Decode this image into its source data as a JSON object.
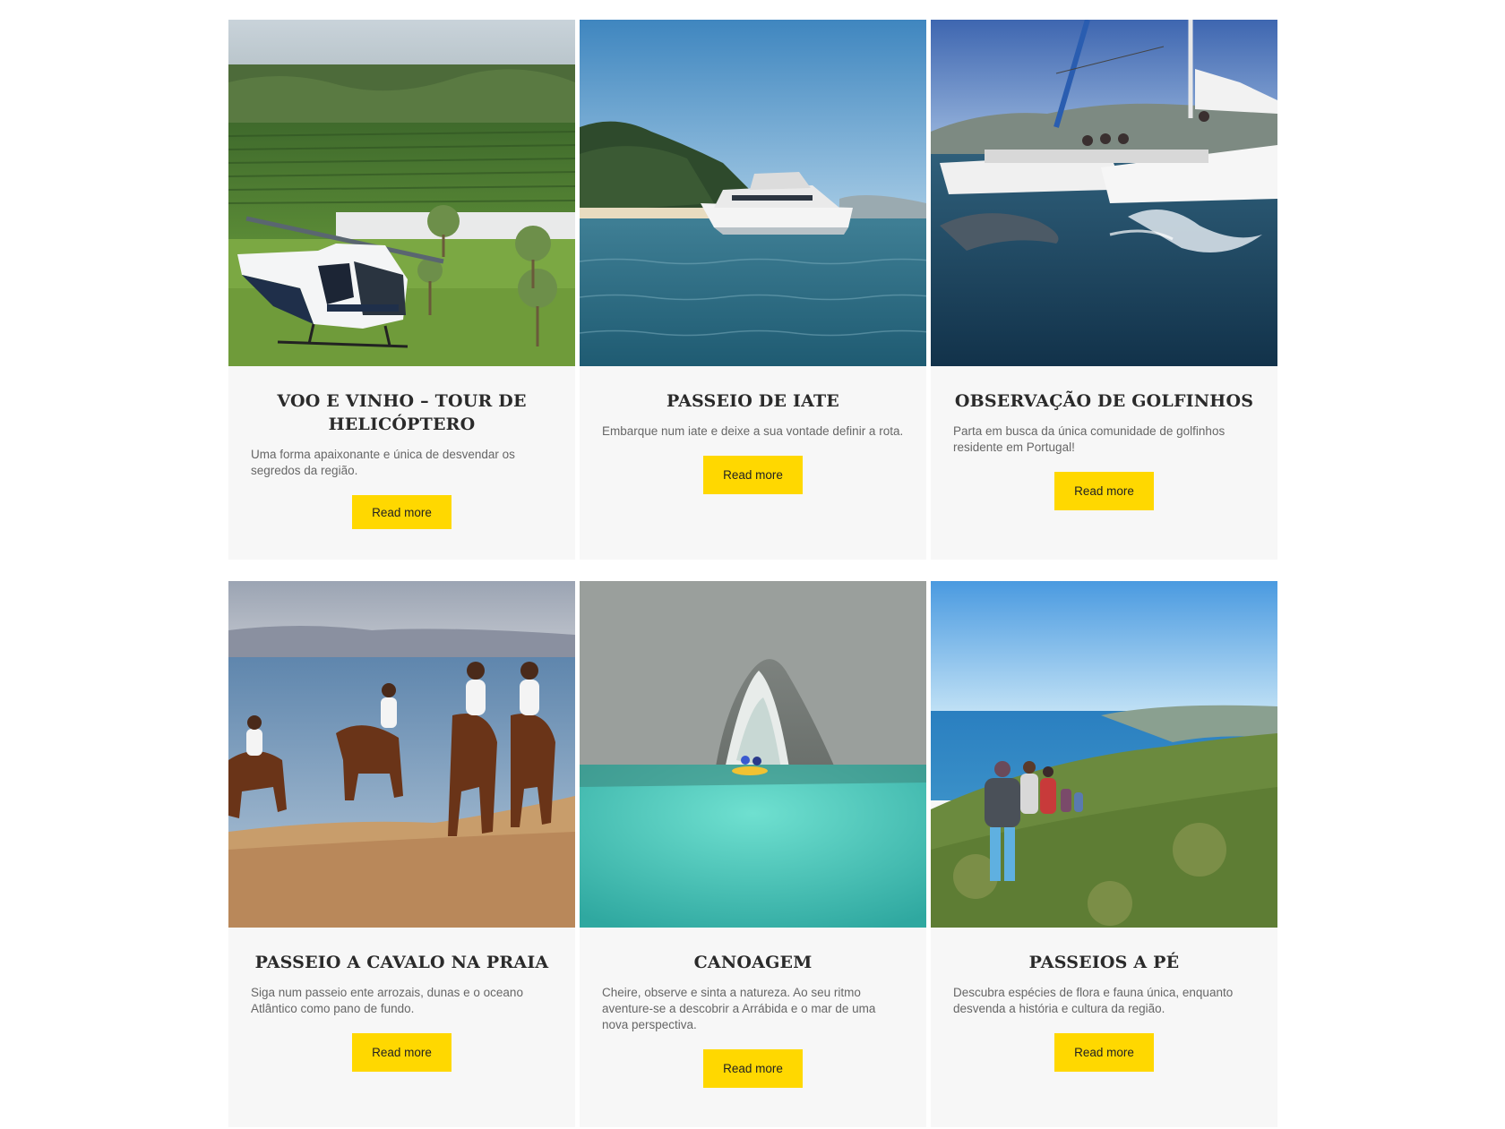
{
  "cards": [
    {
      "title": "VOO E VINHO – TOUR DE HELICÓPTERO",
      "description": "Uma forma apaixonante e única de desvendar os segredos da região.",
      "button_label": "Read more",
      "image": "helicopter-vineyard-photo"
    },
    {
      "title": "PASSEIO DE IATE",
      "description": "Embarque num iate e deixe a sua vontade definir a rota.",
      "button_label": "Read more",
      "image": "yacht-photo"
    },
    {
      "title": "OBSERVAÇÃO DE GOLFINHOS",
      "description": "Parta em busca da única comunidade de golfinhos residente em Portugal!",
      "button_label": "Read more",
      "image": "catamaran-dolphins-photo"
    },
    {
      "title": "PASSEIO A CAVALO NA PRAIA",
      "description": "Siga num passeio ente arrozais, dunas e o oceano Atlântico como pano de fundo.",
      "button_label": "Read more",
      "image": "horse-riding-beach-photo"
    },
    {
      "title": "CANOAGEM",
      "description": "Cheire, observe e sinta a natureza. Ao seu ritmo aventure-se a descobrir a Arrábida e o mar de uma nova perspectiva.",
      "button_label": "Read more",
      "image": "canoe-sea-cave-photo"
    },
    {
      "title": "PASSEIOS A PÉ",
      "description": "Descubra espécies de flora e fauna única, enquanto desvenda a história e cultura da região.",
      "button_label": "Read more",
      "image": "hiking-coast-photo"
    }
  ],
  "colors": {
    "button": "#ffd800",
    "card_background": "#f7f7f7",
    "title": "#2a2a2a",
    "text": "#666666"
  }
}
